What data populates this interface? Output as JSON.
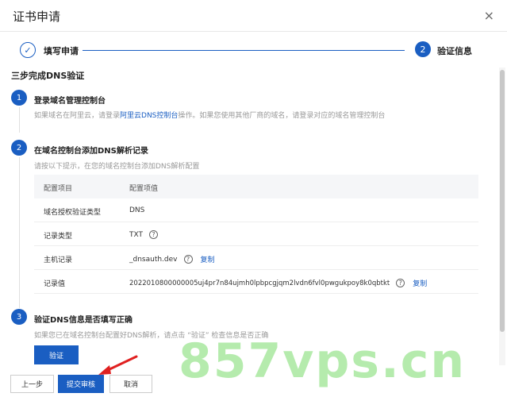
{
  "dialog": {
    "title": "证书申请",
    "close_icon": "×"
  },
  "steps": [
    {
      "label": "填写申请",
      "icon": "✓"
    },
    {
      "label": "验证信息",
      "number": "2"
    }
  ],
  "content": {
    "section_title": "三步完成DNS验证",
    "step1": {
      "number": "1",
      "title": "登录域名管理控制台",
      "desc_before": "如果域名在阿里云，请登录",
      "desc_link": "阿里云DNS控制台",
      "desc_after": "操作。如果您使用其他厂商的域名，请登录对应的域名管理控制台"
    },
    "step2": {
      "number": "2",
      "title": "在域名控制台添加DNS解析记录",
      "desc": "请按以下提示，在您的域名控制台添加DNS解析配置"
    },
    "table": {
      "header": {
        "c1": "配置项目",
        "c2": "配置项值"
      },
      "rows": [
        {
          "c1": "域名授权验证类型",
          "c2": "DNS"
        },
        {
          "c1": "记录类型",
          "c2": "TXT"
        },
        {
          "c1": "主机记录",
          "c2": "_dnsauth.dev",
          "copy": "复制"
        },
        {
          "c1": "记录值",
          "c2": "2022010800000005uj4pr7n84ujmh0lpbpcgjqm2lvdn6fvl0pwgukpoy8k0qbtkt",
          "copy": "复制"
        }
      ]
    },
    "step3": {
      "number": "3",
      "title": "验证DNS信息是否填写正确",
      "desc": "如果您已在域名控制台配置好DNS解析，请点击 “验证” 检查信息是否正确"
    },
    "verify_button": "验证"
  },
  "footer": {
    "prev": "上一步",
    "submit": "提交审核",
    "cancel": "取消"
  },
  "watermark": "857vps.cn",
  "colors": {
    "primary": "#1a5ec2",
    "arrow": "#e02020",
    "watermark": "#a0e696"
  }
}
